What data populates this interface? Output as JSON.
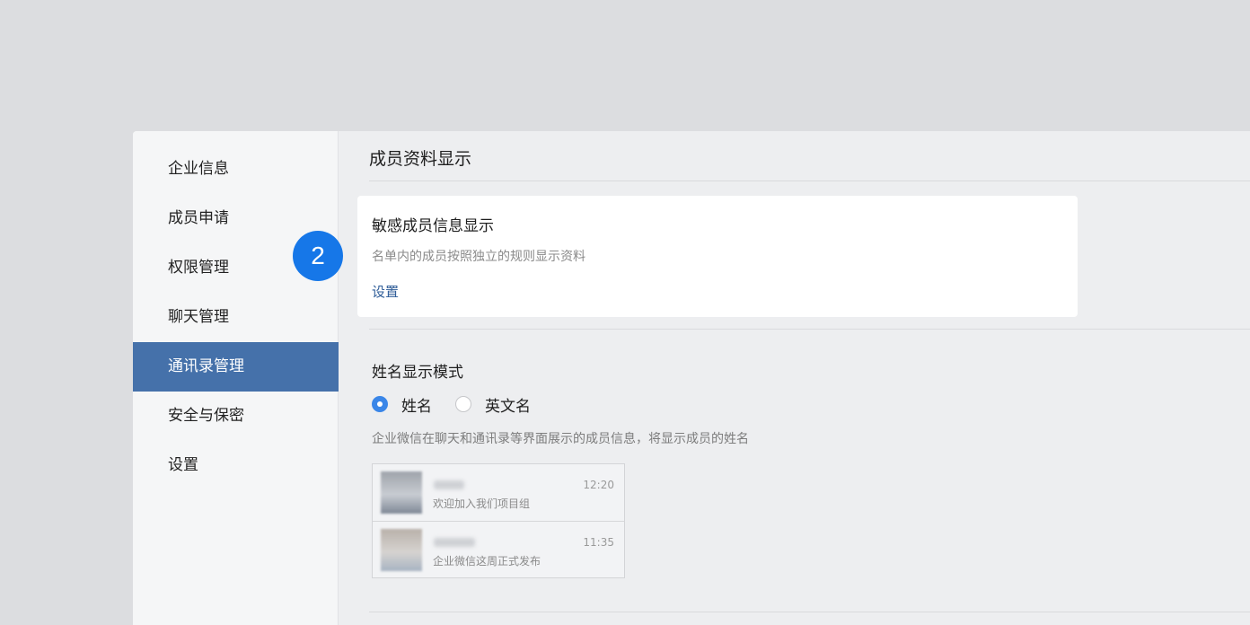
{
  "sidebar": {
    "items": [
      {
        "label": "企业信息",
        "active": false
      },
      {
        "label": "成员申请",
        "active": false
      },
      {
        "label": "权限管理",
        "active": false
      },
      {
        "label": "聊天管理",
        "active": false
      },
      {
        "label": "通讯录管理",
        "active": true
      },
      {
        "label": "安全与保密",
        "active": false
      },
      {
        "label": "设置",
        "active": false
      }
    ]
  },
  "main": {
    "section_title": "成员资料显示",
    "sensitive_card": {
      "title": "敏感成员信息显示",
      "description": "名单内的成员按照独立的规则显示资料",
      "link_label": "设置"
    },
    "name_mode": {
      "title": "姓名显示模式",
      "options": [
        {
          "label": "姓名",
          "checked": true
        },
        {
          "label": "英文名",
          "checked": false
        }
      ],
      "description": "企业微信在聊天和通讯录等界面展示的成员信息，将显示成员的姓名",
      "preview": [
        {
          "message": "欢迎加入我们项目组",
          "time": "12:20"
        },
        {
          "message": "企业微信这周正式发布",
          "time": "11:35"
        }
      ]
    }
  },
  "badge": {
    "label": "2",
    "color": "#1677e8"
  },
  "colors": {
    "accent": "#4571aa",
    "link": "#2f5d98",
    "radio": "#3a86e8"
  }
}
